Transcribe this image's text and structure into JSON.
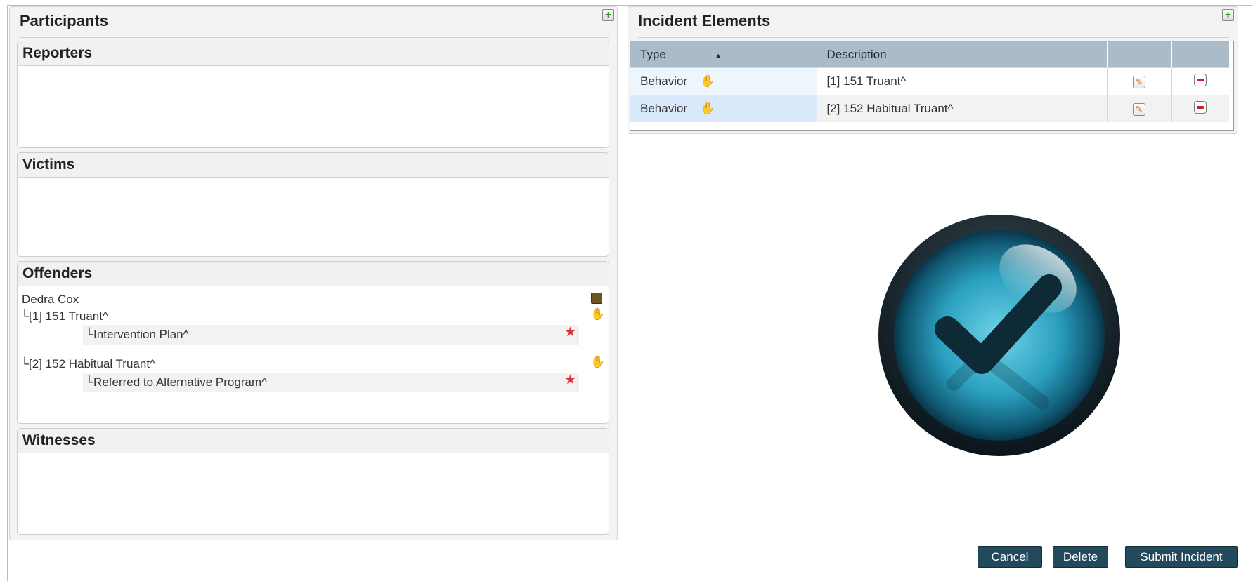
{
  "participants": {
    "title": "Participants",
    "add_icon": "plus-icon",
    "reporters": {
      "title": "Reporters"
    },
    "victims": {
      "title": "Victims"
    },
    "offenders": {
      "title": "Offenders",
      "name": "Dedra Cox",
      "items": [
        {
          "label": "[1] 151 Truant^",
          "action": "Intervention Plan^"
        },
        {
          "label": "[2] 152 Habitual Truant^",
          "action": "Referred to Alternative Program^"
        }
      ],
      "icons": {
        "case": "briefcase-icon",
        "hand": "hand-icon",
        "star": "star-icon"
      }
    },
    "witnesses": {
      "title": "Witnesses"
    }
  },
  "incident": {
    "title": "Incident Elements",
    "add_icon": "plus-icon",
    "columns": {
      "type": "Type",
      "description": "Description"
    },
    "sort_indicator": "▲",
    "rows": [
      {
        "type": "Behavior",
        "description": "[1] 151 Truant^"
      },
      {
        "type": "Behavior",
        "description": "[2] 152 Habitual Truant^"
      }
    ]
  },
  "overlay": {
    "icon": "checkmark-icon",
    "color": "#2a9fbe"
  },
  "buttons": {
    "cancel": "Cancel",
    "delete": "Delete",
    "submit": "Submit Incident"
  },
  "colors": {
    "button_bg": "#234a5c",
    "header_bg": "#abbbc7",
    "plus": "#2c9a2c",
    "minus": "#d11d2a",
    "star": "#e0313a"
  }
}
